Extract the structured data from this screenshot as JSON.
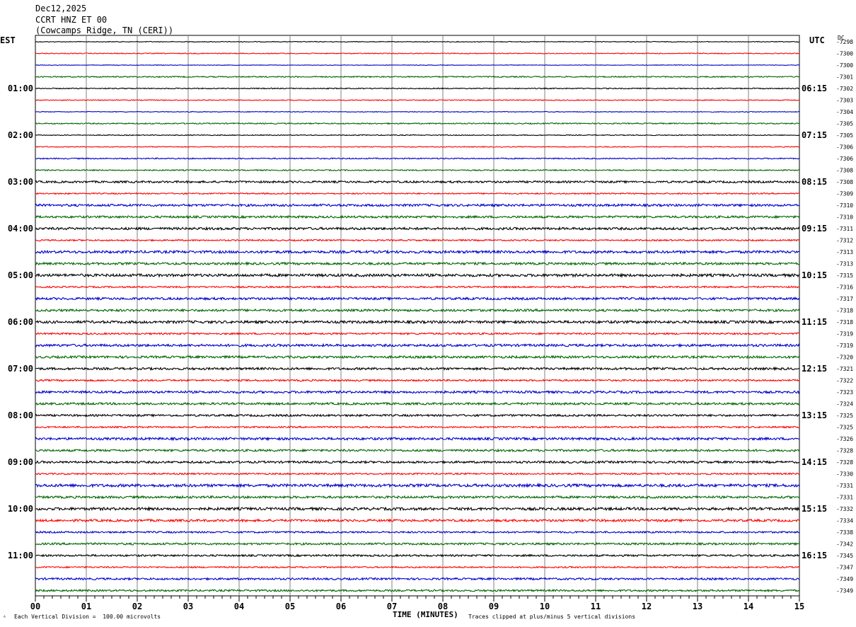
{
  "header": {
    "date": "Dec12,2025",
    "station": "CCRT HNZ ET 00",
    "location": "(Cowcamps Ridge, TN (CERI))"
  },
  "left_timezone": "EST",
  "right_timezone": "UTC",
  "dc_label": "DC",
  "footer": {
    "scale_note": "Each Vertical Division =  100.00 microvolts",
    "xlabel": "TIME (MINUTES)",
    "clip_note": "Traces clipped at plus/minus 5 vertical divisions",
    "corner_mark": "ᴬ"
  },
  "colors": {
    "trace_cycle": [
      "#000000",
      "#ff0000",
      "#0000cc",
      "#006600"
    ],
    "grid": "#808080",
    "background": "#ffffff"
  },
  "chart_data": {
    "type": "line",
    "title": "",
    "xlabel": "TIME (MINUTES)",
    "xlim": [
      0,
      15
    ],
    "x_ticks": [
      "00",
      "01",
      "02",
      "03",
      "04",
      "05",
      "06",
      "07",
      "08",
      "09",
      "10",
      "11",
      "12",
      "13",
      "14",
      "15"
    ],
    "left_hour_labels": [
      "01:00",
      "02:00",
      "03:00",
      "04:00",
      "05:00",
      "06:00",
      "07:00",
      "08:00",
      "09:00",
      "10:00",
      "11:00"
    ],
    "right_hour_labels": [
      "06:15",
      "07:15",
      "08:15",
      "09:15",
      "10:15",
      "11:15",
      "12:15",
      "13:15",
      "14:15",
      "15:15",
      "16:15"
    ],
    "dc_offsets": [
      "-7298",
      "-7300",
      "-7300",
      "-7301",
      "-7302",
      "-7303",
      "-7304",
      "-7305",
      "-7305",
      "-7306",
      "-7306",
      "-7308",
      "-7308",
      "-7309",
      "-7310",
      "-7310",
      "-7311",
      "-7312",
      "-7313",
      "-7313",
      "-7315",
      "-7316",
      "-7317",
      "-7318",
      "-7318",
      "-7319",
      "-7319",
      "-7320",
      "-7321",
      "-7322",
      "-7323",
      "-7324",
      "-7325",
      "-7325",
      "-7326",
      "-7328",
      "-7328",
      "-7330",
      "-7331",
      "-7331",
      "-7332",
      "-7334",
      "-7338",
      "-7342",
      "-7345",
      "-7347",
      "-7349",
      "-7349"
    ],
    "trace_noise_levels": [
      0.5,
      0.6,
      0.4,
      0.8,
      0.7,
      0.6,
      0.5,
      0.8,
      0.6,
      0.6,
      0.8,
      0.8,
      1.4,
      0.9,
      1.6,
      1.5,
      1.7,
      1.0,
      1.8,
      1.6,
      1.9,
      1.1,
      1.6,
      1.6,
      1.8,
      1.2,
      1.7,
      1.6,
      1.6,
      1.2,
      1.6,
      1.5,
      1.4,
      1.1,
      1.7,
      1.5,
      1.5,
      1.1,
      2.0,
      1.6,
      1.9,
      1.6,
      1.2,
      1.4,
      1.3,
      1.0,
      1.4,
      1.3
    ]
  }
}
